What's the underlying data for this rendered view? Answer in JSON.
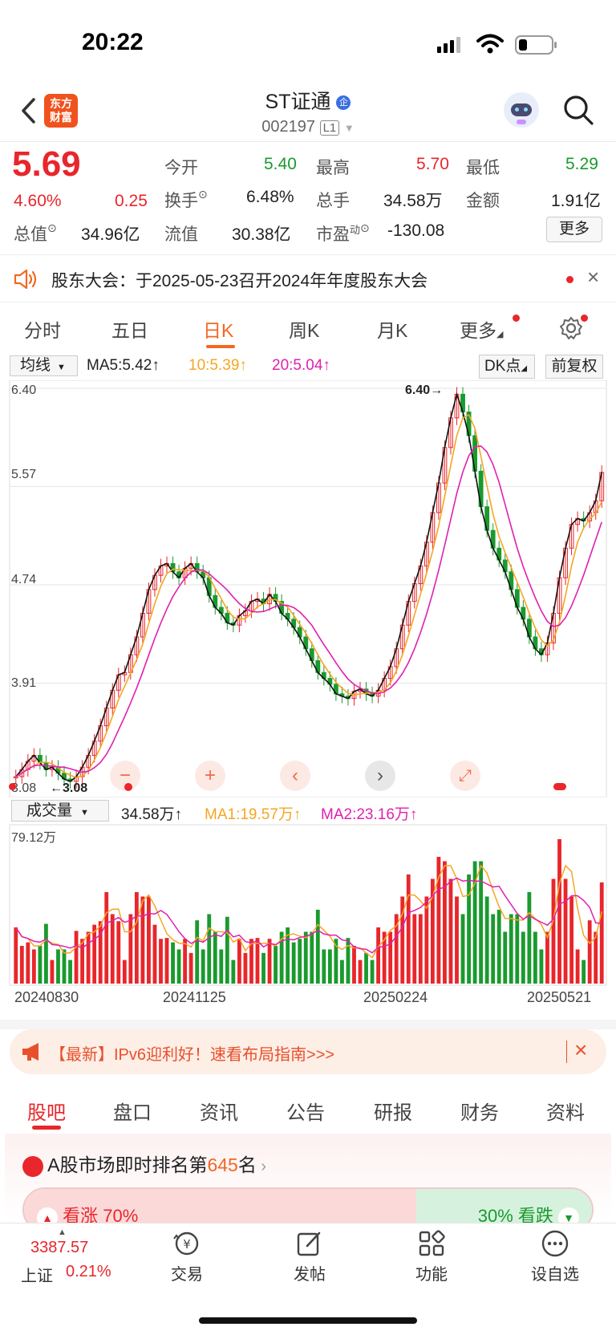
{
  "status_bar": {
    "time": "20:22"
  },
  "header": {
    "logo_text_1": "东方",
    "logo_text_2": "财富",
    "name": "ST证通",
    "badge": "企",
    "code": "002197",
    "level": "L1"
  },
  "quote": {
    "price": "5.69",
    "change_pct": "4.60%",
    "change": "0.25",
    "open_label": "今开",
    "open": "5.40",
    "high_label": "最高",
    "high": "5.70",
    "low_label": "最低",
    "low": "5.29",
    "turnover_label": "换手",
    "turnover": "6.48%",
    "volume_label": "总手",
    "volume": "34.58万",
    "amount_label": "金额",
    "amount": "1.91亿",
    "mktcap_label": "总值",
    "mktcap": "34.96亿",
    "float_label": "流值",
    "float": "30.38亿",
    "pe_label": "市盈",
    "pe_sup": "动",
    "pe": "-130.08",
    "more_button": "更多"
  },
  "notice": {
    "text": "股东大会：于2025-05-23召开2024年年度股东大会"
  },
  "period_tabs": [
    "分时",
    "五日",
    "日K",
    "周K",
    "月K",
    "更多"
  ],
  "kline": {
    "indicator": "均线",
    "ma5": "MA5:5.42↑",
    "ma10": "10:5.39↑",
    "ma20": "20:5.04↑",
    "dk_button": "DK点",
    "adjust_button": "前复权",
    "y_ticks": [
      "6.40",
      "5.57",
      "4.74",
      "3.91",
      "3.08"
    ],
    "high_marker": "6.40",
    "low_marker": "3.08"
  },
  "volume": {
    "indicator": "成交量",
    "value": "34.58万↑",
    "ma1": "MA1:19.57万↑",
    "ma2": "MA2:23.16万↑",
    "max_label": "79.12万",
    "dates": [
      "20240830",
      "20241125",
      "20250224",
      "20250521"
    ]
  },
  "chart_data": {
    "type": "candlestick",
    "ylim": [
      3.08,
      6.4
    ],
    "close_approx": [
      3.12,
      3.18,
      3.25,
      3.3,
      3.24,
      3.18,
      3.2,
      3.15,
      3.1,
      3.08,
      3.12,
      3.2,
      3.3,
      3.42,
      3.55,
      3.7,
      3.85,
      3.98,
      4.0,
      4.15,
      4.3,
      4.5,
      4.7,
      4.82,
      4.9,
      4.92,
      4.85,
      4.8,
      4.88,
      4.92,
      4.85,
      4.8,
      4.65,
      4.55,
      4.5,
      4.42,
      4.4,
      4.48,
      4.52,
      4.6,
      4.62,
      4.58,
      4.66,
      4.6,
      4.5,
      4.45,
      4.38,
      4.3,
      4.2,
      4.1,
      4.0,
      3.95,
      3.9,
      3.82,
      3.8,
      3.78,
      3.84,
      3.86,
      3.82,
      3.8,
      3.85,
      3.95,
      4.05,
      4.2,
      4.4,
      4.6,
      4.75,
      4.9,
      5.1,
      5.35,
      5.6,
      5.9,
      6.15,
      6.35,
      6.2,
      6.0,
      5.7,
      5.4,
      5.2,
      5.05,
      4.95,
      4.85,
      4.7,
      4.55,
      4.45,
      4.3,
      4.2,
      4.15,
      4.25,
      4.5,
      4.8,
      5.05,
      5.25,
      5.3,
      5.28,
      5.35,
      5.45,
      5.69
    ]
  },
  "promo": {
    "text": "【最新】IPv6迎利好！速看布局指南>>>"
  },
  "info_tabs": [
    "股吧",
    "盘口",
    "资讯",
    "公告",
    "研报",
    "财务",
    "资料"
  ],
  "ranking": {
    "prefix": "A股市场即时排名第",
    "rank": "645",
    "suffix": "名"
  },
  "sentiment": {
    "up": "看涨 70%",
    "down": "30% 看跌"
  },
  "index": {
    "value": "3387.57",
    "name": "上证",
    "pct": "0.21%"
  },
  "bottom_nav": [
    "交易",
    "发帖",
    "功能",
    "设自选"
  ]
}
